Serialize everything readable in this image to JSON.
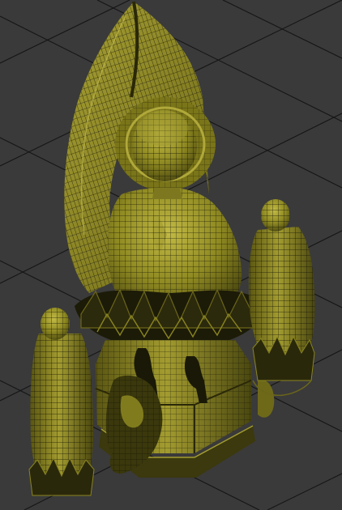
{
  "viewport": {
    "label": "",
    "view": "perspective",
    "shading": "smooth-shaded-with-wireframe",
    "grid_visible": true
  },
  "colors": {
    "background": "#3a3a3a",
    "grid_line": "#151515",
    "model_fill": "#8f8a22",
    "model_highlight": "#b7b03d",
    "model_shadow": "#4a4710",
    "wire": "#141405"
  },
  "model": {
    "name": "",
    "parts": [
      "mandorla",
      "halo",
      "seated-buddha",
      "lotus-throne",
      "octagonal-pedestal",
      "lion-guardian",
      "attendant-figure-left",
      "attendant-figure-right"
    ]
  }
}
